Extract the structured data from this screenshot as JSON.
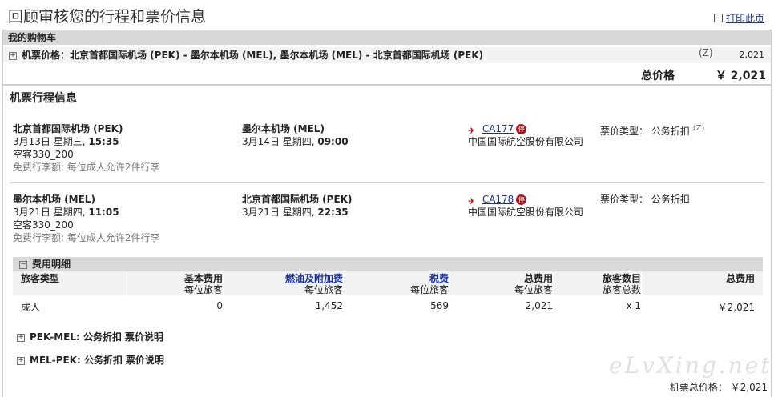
{
  "page_title": "回顾审核您的行程和票价信息",
  "print_label": "打印此页",
  "cart": {
    "header": "我的购物车",
    "item_label": "机票价格：北京首都国际机场",
    "route_text": "机票价格：北京首都国际机场 (PEK) - 墨尔本机场 (MEL), 墨尔本机场 (MEL) - 北京首都国际机场 (PEK)",
    "z_mark": "(Z)",
    "item_price": "2,021",
    "total_label": "总价格",
    "total_value": "￥ 2,021"
  },
  "itinerary": {
    "title": "机票行程信息",
    "segments": [
      {
        "from": "北京首都国际机场 (PEK)",
        "dep_date": "3月13日  星期三, ",
        "dep_time": "15:35",
        "aircraft": "空客330_200",
        "baggage": "免费行李额: 每位成人允许2件行李",
        "to": "墨尔本机场 (MEL)",
        "arr_date": "3月14日  星期四, ",
        "arr_time": "09:00",
        "flight": "CA177",
        "airline": "中国国际航空股份有限公司",
        "fare_label": "票价类型：",
        "fare_type": "公务折扣",
        "z_mark": "(Z)"
      },
      {
        "from": "墨尔本机场 (MEL)",
        "dep_date": "3月21日  星期四, ",
        "dep_time": "11:05",
        "aircraft": "空客330_200",
        "baggage": "免费行李额: 每位成人允许2件行李",
        "to": "北京首都国际机场 (PEK)",
        "arr_date": "3月21日  星期四, ",
        "arr_time": "22:35",
        "flight": "CA178",
        "airline": "中国国际航空股份有限公司",
        "fare_label": "票价类型：",
        "fare_type": "公务折扣"
      }
    ]
  },
  "fees": {
    "header": "费用明细",
    "columns": [
      {
        "title": "旅客类型",
        "sub": ""
      },
      {
        "title": "基本费用",
        "sub": "每位旅客"
      },
      {
        "title": "燃油及附加费",
        "sub": "每位旅客"
      },
      {
        "title": "税费",
        "sub": "每位旅客"
      },
      {
        "title": "总费用",
        "sub": "每位旅客"
      },
      {
        "title": "旅客数目",
        "sub": "旅客总数"
      },
      {
        "title": "总费用",
        "sub": ""
      }
    ],
    "row": {
      "type": "成人",
      "base": "0",
      "fuel": "1,452",
      "tax": "569",
      "per_total": "2,021",
      "count": "x 1",
      "total": "￥2,021"
    }
  },
  "rules": [
    {
      "route": "PEK-MEL: 公务折扣",
      "link": "票价说明"
    },
    {
      "route": "MEL-PEK: 公务折扣",
      "link": "票价说明"
    }
  ],
  "footer_total": "机票总价格：  ￥2,021",
  "watermark": "eLvXing.net"
}
